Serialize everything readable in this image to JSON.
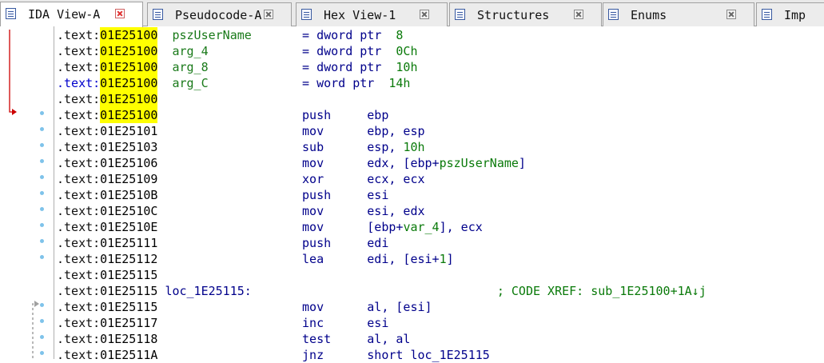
{
  "tabs": [
    {
      "label": "IDA View-A",
      "active": true,
      "closable": true
    },
    {
      "label": "Pseudocode-A",
      "active": false,
      "closable": true
    },
    {
      "label": "Hex View-1",
      "active": false,
      "closable": true
    },
    {
      "label": "Structures",
      "active": false,
      "closable": true
    },
    {
      "label": "Enums",
      "active": false,
      "closable": true
    },
    {
      "label": "Imp",
      "active": false,
      "closable": false
    }
  ],
  "listing": {
    "segment": ".text:",
    "rows": [
      {
        "addr": "01E25100",
        "name": "pszUserName",
        "op": "= dword ptr",
        "arg": "8"
      },
      {
        "addr": "01E25100",
        "name": "arg_4",
        "op": "= dword ptr",
        "arg": "0Ch"
      },
      {
        "addr": "01E25100",
        "name": "arg_8",
        "op": "= dword ptr",
        "arg": "10h"
      },
      {
        "addr": "01E25100",
        "name": "arg_C",
        "op": "= word ptr",
        "arg": "14h"
      },
      {
        "addr": "01E25100"
      },
      {
        "addr": "01E25100",
        "mnem": "push",
        "ops": [
          [
            "ebp",
            "k"
          ]
        ]
      },
      {
        "addr": "01E25101",
        "mnem": "mov",
        "ops": [
          [
            "ebp, esp",
            "k"
          ]
        ]
      },
      {
        "addr": "01E25103",
        "mnem": "sub",
        "ops": [
          [
            "esp, ",
            "k"
          ],
          [
            "10h",
            "g"
          ]
        ]
      },
      {
        "addr": "01E25106",
        "mnem": "mov",
        "ops": [
          [
            "edx, [ebp+",
            "k"
          ],
          [
            "pszUserName",
            "g"
          ],
          [
            "]",
            "k"
          ]
        ]
      },
      {
        "addr": "01E25109",
        "mnem": "xor",
        "ops": [
          [
            "ecx, ecx",
            "k"
          ]
        ]
      },
      {
        "addr": "01E2510B",
        "mnem": "push",
        "ops": [
          [
            "esi",
            "k"
          ]
        ]
      },
      {
        "addr": "01E2510C",
        "mnem": "mov",
        "ops": [
          [
            "esi, edx",
            "k"
          ]
        ]
      },
      {
        "addr": "01E2510E",
        "mnem": "mov",
        "ops": [
          [
            "[ebp+",
            "k"
          ],
          [
            "var_4",
            "g"
          ],
          [
            "], ecx",
            "k"
          ]
        ]
      },
      {
        "addr": "01E25111",
        "mnem": "push",
        "ops": [
          [
            "edi",
            "k"
          ]
        ]
      },
      {
        "addr": "01E25112",
        "mnem": "lea",
        "ops": [
          [
            "edi, [esi+",
            "k"
          ],
          [
            "1",
            "g"
          ],
          [
            "]",
            "k"
          ]
        ]
      },
      {
        "addr": "01E25115"
      },
      {
        "addr": "01E25115",
        "label": "loc_1E25115:",
        "comment": "; CODE XREF: sub_1E25100+1A↓j"
      },
      {
        "addr": "01E25115",
        "mnem": "mov",
        "ops": [
          [
            "al, [esi]",
            "k"
          ]
        ]
      },
      {
        "addr": "01E25117",
        "mnem": "inc",
        "ops": [
          [
            "esi",
            "k"
          ]
        ]
      },
      {
        "addr": "01E25118",
        "mnem": "test",
        "ops": [
          [
            "al, al",
            "k"
          ]
        ]
      },
      {
        "addr": "01E2511A",
        "mnem": "jnz",
        "ops": [
          [
            "short loc_1E25115",
            "k"
          ]
        ]
      }
    ]
  },
  "colors": {
    "highlight": "#ffff00",
    "name": "#1a7a1a",
    "keyword": "#00008b",
    "branch_arrow": "#cc0000",
    "loop_arrow": "#a0a0a0",
    "bullet": "#7ec3ea"
  }
}
